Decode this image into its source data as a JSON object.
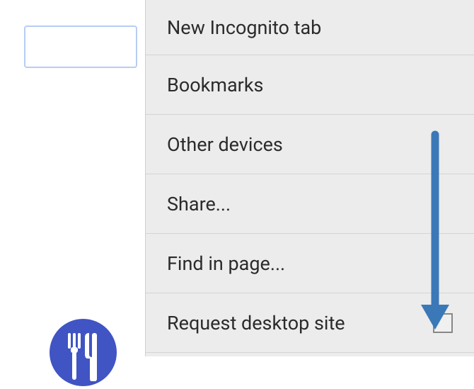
{
  "search": {
    "placeholder": ""
  },
  "menu": {
    "items": [
      {
        "label": "New Incognito tab",
        "hasCheckbox": false
      },
      {
        "label": "Bookmarks",
        "hasCheckbox": false
      },
      {
        "label": "Other devices",
        "hasCheckbox": false
      },
      {
        "label": "Share...",
        "hasCheckbox": false
      },
      {
        "label": "Find in page...",
        "hasCheckbox": false
      },
      {
        "label": "Request desktop site",
        "hasCheckbox": true
      }
    ]
  },
  "annotation": {
    "arrowColor": "#3b78b8"
  },
  "appIcon": {
    "bgColor": "#4054c3"
  }
}
